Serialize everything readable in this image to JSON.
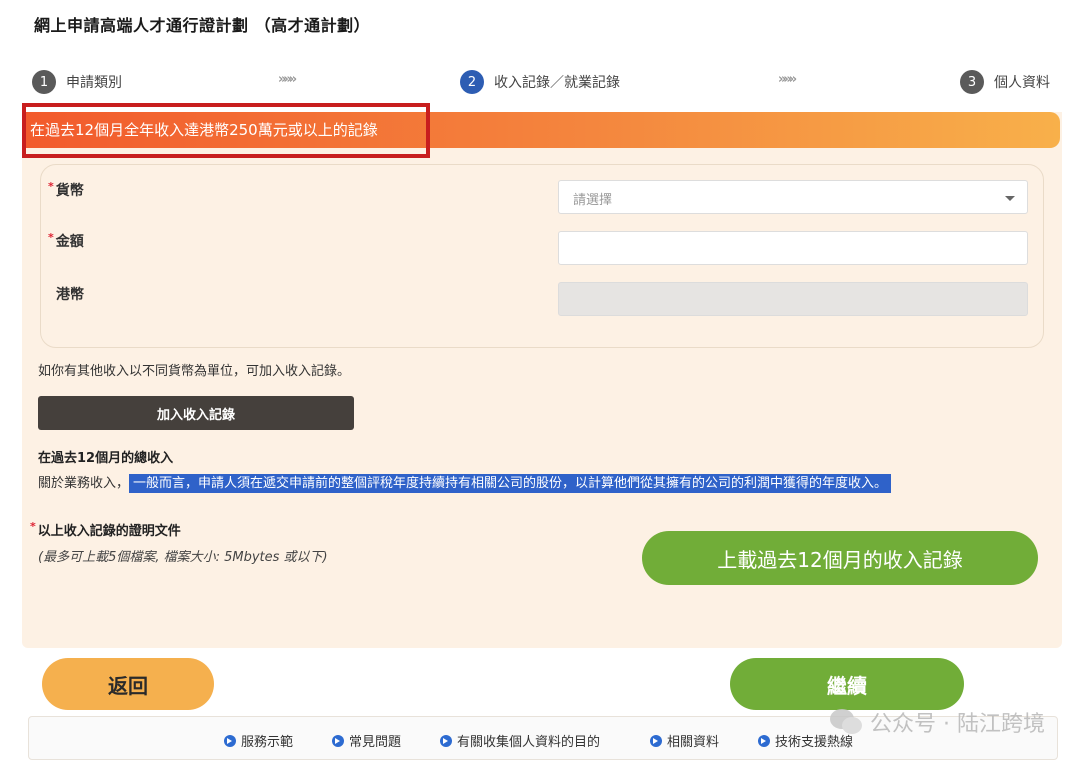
{
  "page_title": "網上申請高端人才通行證計劃 （高才通計劃）",
  "steps": [
    {
      "number": "1",
      "label": "申請類別"
    },
    {
      "number": "2",
      "label": "收入記錄／就業記錄"
    },
    {
      "number": "3",
      "label": "個人資料"
    }
  ],
  "step_arrow": "»»»",
  "banner": {
    "text": "在過去12個月全年收入達港幣250萬元或以上的記錄"
  },
  "form": {
    "required_marker": "*",
    "currency_label": "貨幣",
    "currency_placeholder": "請選擇",
    "amount_label": "金額",
    "hkd_label": "港幣"
  },
  "hint": "如你有其他收入以不同貨幣為單位，可加入收入記錄。",
  "add_record_button": "加入收入記錄",
  "total_income": {
    "title": "在過去12個月的總收入",
    "prefix": "關於業務收入，",
    "highlighted": "一般而言，申請人須在遞交申請前的整個評稅年度持續持有相關公司的股份，以計算他們從其擁有的公司的利潤中獲得的年度收入。"
  },
  "documents": {
    "title": "以上收入記錄的證明文件",
    "note": "(最多可上載5個檔案, 檔案大小: 5Mbytes 或以下)"
  },
  "upload_button": "上載過去12個月的收入記錄",
  "back_button": "返回",
  "next_button": "繼續",
  "footer_links": [
    "服務示範",
    "常見問題",
    "有關收集個人資料的目的",
    "相關資料",
    "技術支援熱線"
  ],
  "watermark": "公众号 · 陆江跨境",
  "colors": {
    "banner_start": "#f25a2c",
    "banner_end": "#f8b04a",
    "panel_bg": "#fdf1e4",
    "green_button": "#71ad38",
    "orange_button": "#f5b04e",
    "active_step": "#2d5db3",
    "highlight_border": "#c81e1e"
  }
}
